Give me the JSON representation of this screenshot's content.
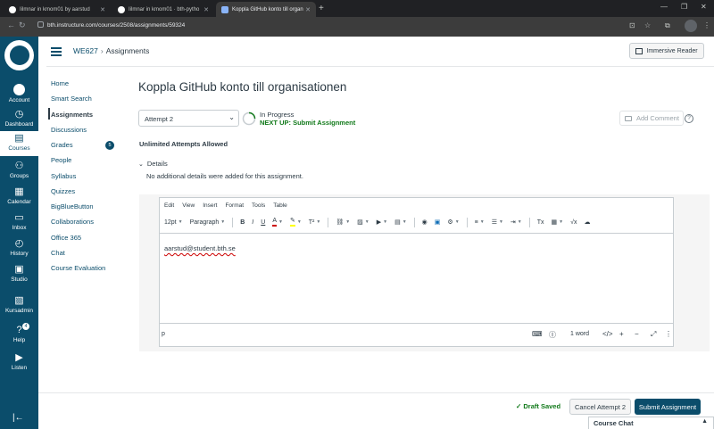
{
  "browser": {
    "tabs": [
      {
        "label": "Iilmnar in kmom01 by aarstud"
      },
      {
        "label": "Iilmnar in kmom01 · bth-pytho"
      },
      {
        "label": "Koppla GitHub konto till organ"
      }
    ],
    "new_tab": "+",
    "url": "bth.instructure.com/courses/2508/assignments/59324"
  },
  "global_nav": {
    "items": [
      {
        "label": "Account",
        "icon": "account-icon",
        "glyph": ""
      },
      {
        "label": "Dashboard",
        "icon": "dashboard-icon",
        "glyph": "◷"
      },
      {
        "label": "Courses",
        "icon": "courses-icon",
        "glyph": "▤"
      },
      {
        "label": "Groups",
        "icon": "groups-icon",
        "glyph": "⚇"
      },
      {
        "label": "Calendar",
        "icon": "calendar-icon",
        "glyph": "▦"
      },
      {
        "label": "Inbox",
        "icon": "inbox-icon",
        "glyph": "▭"
      },
      {
        "label": "History",
        "icon": "history-icon",
        "glyph": "◴"
      },
      {
        "label": "Studio",
        "icon": "studio-icon",
        "glyph": "▣"
      },
      {
        "label": "Kursadmin",
        "icon": "kursadmin-icon",
        "glyph": "▧"
      },
      {
        "label": "Help",
        "icon": "help-icon",
        "glyph": "?",
        "badge": "4"
      },
      {
        "label": "Listen",
        "icon": "listen-icon",
        "glyph": "▶"
      }
    ],
    "collapse_glyph": "|←"
  },
  "header": {
    "course": "WE627",
    "section": "Assignments",
    "immersive_reader": "Immersive Reader"
  },
  "course_nav": {
    "items": [
      {
        "label": "Home"
      },
      {
        "label": "Smart Search"
      },
      {
        "label": "Assignments",
        "active": true
      },
      {
        "label": "Discussions"
      },
      {
        "label": "Grades",
        "badge": "5"
      },
      {
        "label": "People"
      },
      {
        "label": "Syllabus"
      },
      {
        "label": "Quizzes"
      },
      {
        "label": "BigBlueButton"
      },
      {
        "label": "Collaborations"
      },
      {
        "label": "Office 365"
      },
      {
        "label": "Chat"
      },
      {
        "label": "Course Evaluation"
      }
    ]
  },
  "assignment": {
    "title": "Koppla GitHub konto till organisationen",
    "attempt_selected": "Attempt 2",
    "status": "In Progress",
    "next_up": "NEXT UP: Submit Assignment",
    "add_comment": "Add Comment",
    "attempts_allowed": "Unlimited Attempts Allowed",
    "details_label": "Details",
    "details_text": "No additional details were added for this assignment."
  },
  "editor": {
    "menu": [
      "Edit",
      "View",
      "Insert",
      "Format",
      "Tools",
      "Table"
    ],
    "font_size": "12pt",
    "block_format": "Paragraph",
    "content": "aarstud@student.bth.se",
    "path": "p",
    "word_count": "1 word"
  },
  "footer": {
    "draft_saved": "Draft Saved",
    "cancel": "Cancel Attempt 2",
    "submit": "Submit Assignment",
    "course_chat": "Course Chat"
  },
  "colors": {
    "brand": "#0b4d6b",
    "success": "#127a1b",
    "text": "#2d3b45"
  }
}
